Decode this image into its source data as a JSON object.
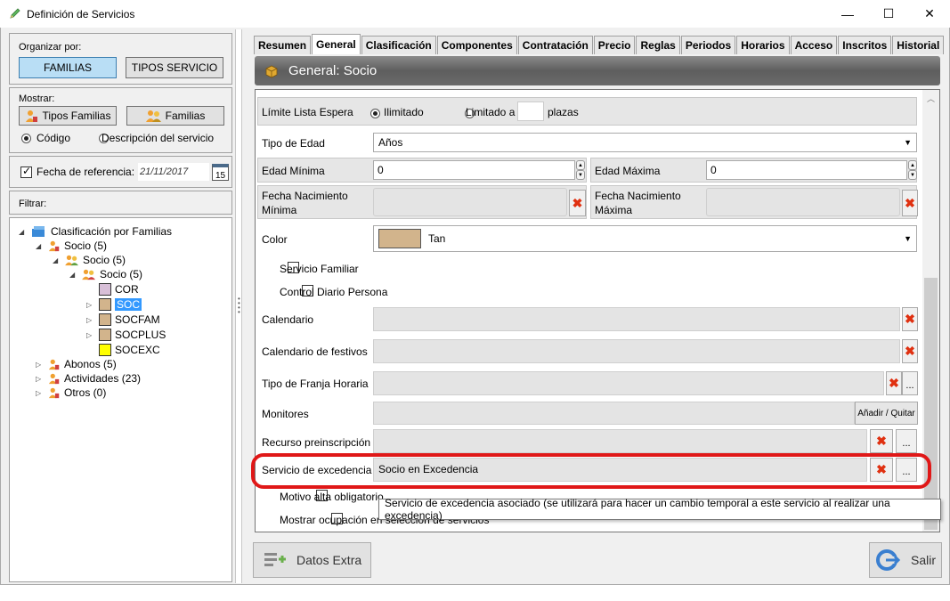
{
  "window": {
    "title": "Definición de Servicios",
    "minimize": "—",
    "maximize": "☐",
    "close": "✕"
  },
  "left": {
    "organize_label": "Organizar por:",
    "btn_familias": "FAMILIAS",
    "btn_tipos": "TIPOS SERVICIO",
    "show_label": "Mostrar:",
    "btn_tipos_familias": "Tipos Familias",
    "btn_familias2": "Familias",
    "radio_codigo": "Código",
    "radio_descripcion": "Descripción del servicio",
    "ref_date_label": "Fecha de referencia:",
    "ref_date_value": "21/11/2017",
    "calendar_day": "15",
    "filter_label": "Filtrar:",
    "tree": {
      "root": "Clasificación por Familias",
      "socio1": "Socio (5)",
      "socio2": "Socio (5)",
      "socio3": "Socio (5)",
      "cor": "COR",
      "soc": "SOC",
      "socfam": "SOCFAM",
      "socplus": "SOCPLUS",
      "socexc": "SOCEXC",
      "abonos": "Abonos (5)",
      "actividades": "Actividades (23)",
      "otros": "Otros (0)"
    },
    "swatches": {
      "cor": "#d8bfd8",
      "soc": "#d2b48c",
      "socfam": "#d2b48c",
      "socplus": "#d2b48c",
      "socexc": "#ffff00"
    }
  },
  "tabs": [
    "Resumen",
    "General",
    "Clasificación",
    "Componentes",
    "Contratación",
    "Precio",
    "Reglas",
    "Periodos",
    "Horarios",
    "Acceso",
    "Inscritos",
    "Historial"
  ],
  "header": {
    "title": "General: Socio"
  },
  "form": {
    "limite_label": "Límite Lista Espera",
    "ilimitado": "Ilimitado",
    "limitado": "Limitado a",
    "plazas": "plazas",
    "tipo_edad_label": "Tipo de Edad",
    "tipo_edad_value": "Años",
    "edad_min_label": "Edad Mínima",
    "edad_min_value": "0",
    "edad_max_label": "Edad Máxima",
    "edad_max_value": "0",
    "fnac_min_label_1": "Fecha Nacimiento",
    "fnac_min_label_2": "Mínima",
    "fnac_max_label_1": "Fecha Nacimiento",
    "fnac_max_label_2": "Máxima",
    "color_label": "Color",
    "color_value": "Tan",
    "color_hex": "#d2b48c",
    "servicio_familiar": "Servicio Familiar",
    "control_diario": "Control Diario Persona",
    "calendario_label": "Calendario",
    "cal_festivos_label": "Calendario de festivos",
    "franja_label": "Tipo de Franja Horaria",
    "monitores_label": "Monitores",
    "anadir_quitar": "Añadir / Quitar",
    "recurso_label": "Recurso preinscripción",
    "excedencia_label": "Servicio de excedencia",
    "excedencia_value": "Socio en Excedencia",
    "motivo_label": "Motivo alta obligatorio",
    "mostrar_label": "Mostrar ocupación en selección de servicios",
    "clear_glyph": "✖",
    "dots": "..."
  },
  "tooltip": "Servicio de excedencia asociado (se utilizará para hacer un cambio temporal a este servicio al realizar una excedencia)",
  "footer": {
    "datos_extra": "Datos Extra",
    "salir": "Salir"
  }
}
